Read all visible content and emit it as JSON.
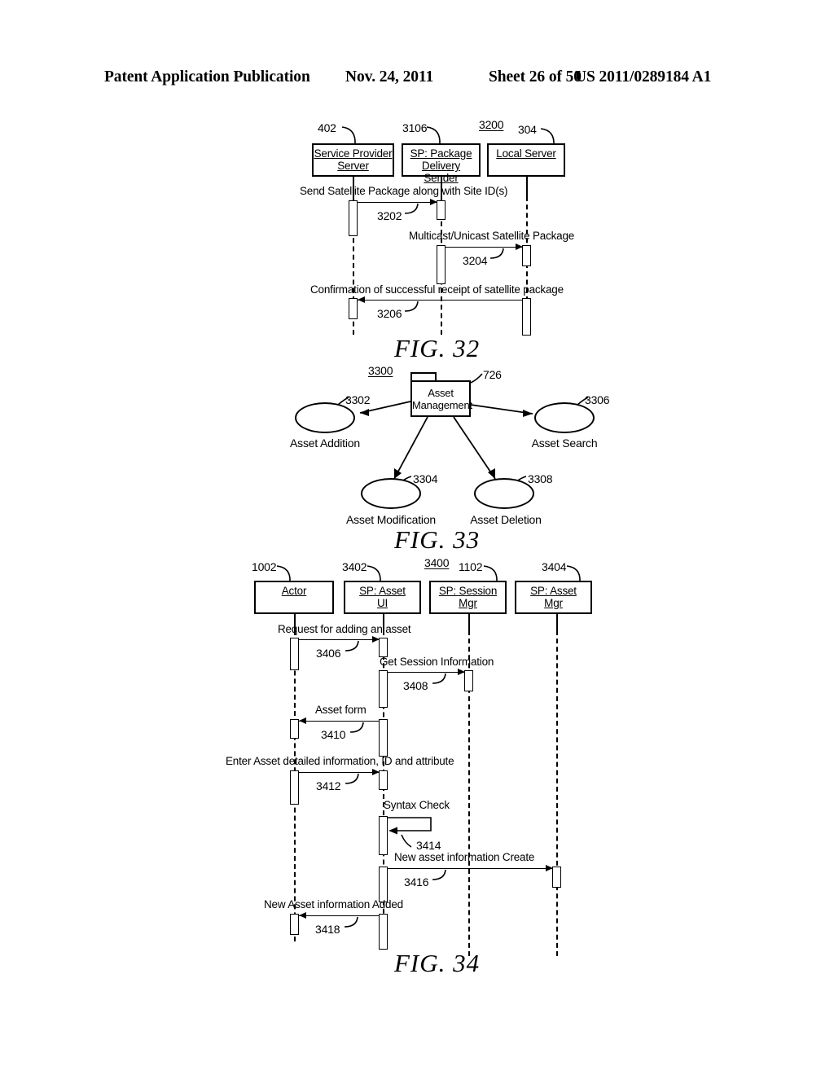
{
  "header": {
    "publication": "Patent Application Publication",
    "date": "Nov. 24, 2011",
    "sheet": "Sheet 26 of 50",
    "patent_number": "US 2011/0289184 A1"
  },
  "fig32": {
    "caption": "FIG.  32",
    "diagram_ref": "3200",
    "participants": [
      {
        "ref": "402",
        "line1": "Service Provider",
        "line2": "Server"
      },
      {
        "ref": "3106",
        "line1": "SP: Package",
        "line2": "Delivery Sender"
      },
      {
        "ref": "304",
        "line1": "Local Server",
        "line2": ""
      }
    ],
    "messages": [
      {
        "ref": "3202",
        "label": "Send Satellite Package along with Site ID(s)"
      },
      {
        "ref": "3204",
        "label": "Multicast/Unicast Satellite Package"
      },
      {
        "ref": "3206",
        "label": "Confirmation of successful receipt of satellite package"
      }
    ]
  },
  "fig33": {
    "caption": "FIG.  33",
    "diagram_ref": "3300",
    "package": {
      "ref": "726",
      "line1": "Asset",
      "line2": "Management"
    },
    "use_cases": [
      {
        "ref": "3302",
        "label": "Asset Addition"
      },
      {
        "ref": "3306",
        "label": "Asset Search"
      },
      {
        "ref": "3304",
        "label": "Asset Modification"
      },
      {
        "ref": "3308",
        "label": "Asset Deletion"
      }
    ]
  },
  "fig34": {
    "caption": "FIG.  34",
    "diagram_ref": "3400",
    "participants": [
      {
        "ref": "1002",
        "line1": "Actor",
        "line2": ""
      },
      {
        "ref": "3402",
        "line1": "SP: Asset",
        "line2": "UI"
      },
      {
        "ref": "1102",
        "line1": "SP: Session",
        "line2": "Mgr"
      },
      {
        "ref": "3404",
        "line1": "SP: Asset",
        "line2": "Mgr"
      }
    ],
    "messages": [
      {
        "ref": "3406",
        "label": "Request for adding an asset"
      },
      {
        "ref": "3408",
        "label": "Get Session Information"
      },
      {
        "ref": "3410",
        "label": "Asset form"
      },
      {
        "ref": "3412",
        "label": "Enter Asset detailed information, ID and attribute"
      },
      {
        "ref": "3414",
        "label": "Syntax Check"
      },
      {
        "ref": "3416",
        "label": "New asset information Create"
      },
      {
        "ref": "3418",
        "label": "New Asset information Added"
      }
    ]
  }
}
